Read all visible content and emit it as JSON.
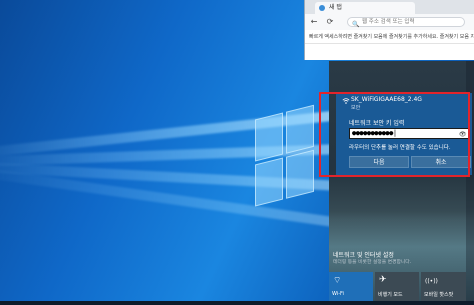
{
  "browser": {
    "tab_title": "새 탭",
    "address_placeholder": "웹 주소 검색 또는 입력",
    "favorites_text": "빠르게 액세스하려면 즐겨찾기 모음에 즐겨찾기를 추가하세요. 즐겨찾기 모음 지금 관리",
    "back": "←",
    "refresh": "⟳",
    "search_glyph": "🔍"
  },
  "wifi": {
    "network_name": "SK_WiFiGIGAAE68_2.4G",
    "status": "보안",
    "key_label": "네트워크 보안 키 입력",
    "key_value": "●●●●●●●●●●●|",
    "reveal_glyph": "👁",
    "router_hint": "라우터의 단추를 눌러 연결할 수도 있습니다.",
    "next_label": "다음",
    "cancel_label": "취소"
  },
  "network_settings": {
    "title": "네트워크 및 인터넷 설정",
    "description": "테더링 등을 비롯한 설정을 변경합니다."
  },
  "quick_actions": [
    {
      "label": "Wi-Fi",
      "icon": "wifi-icon",
      "glyph": "⌔",
      "active": true
    },
    {
      "label": "비행기 모드",
      "icon": "airplane-icon",
      "glyph": "✈",
      "active": false
    },
    {
      "label": "모바일 핫스팟",
      "icon": "hotspot-icon",
      "glyph": "((•))",
      "active": false
    }
  ],
  "colors": {
    "wifi_card": "#1a5a96",
    "highlight_border": "#e3242b",
    "active_tile": "#1f6fb8",
    "inactive_tile": "#3c4a54"
  }
}
